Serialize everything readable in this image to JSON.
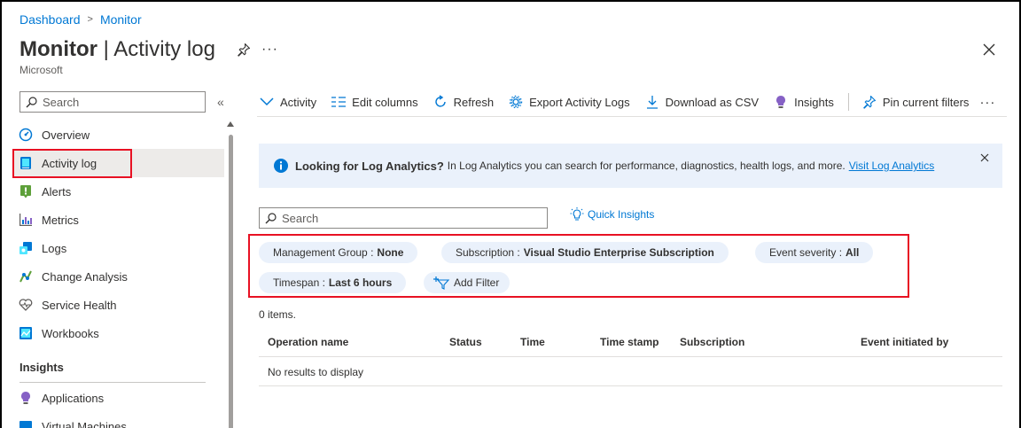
{
  "breadcrumb": {
    "item1": "Dashboard",
    "sep": ">",
    "item2": "Monitor"
  },
  "header": {
    "title_bold": "Monitor",
    "title_rest": " | Activity log",
    "subtitle": "Microsoft",
    "more": "···"
  },
  "sidebar": {
    "search_placeholder": "Search",
    "collapse": "«",
    "items": [
      {
        "label": "Overview",
        "icon": "gauge-icon"
      },
      {
        "label": "Activity log",
        "icon": "activity-log-icon",
        "active": true
      },
      {
        "label": "Alerts",
        "icon": "alerts-icon"
      },
      {
        "label": "Metrics",
        "icon": "metrics-icon"
      },
      {
        "label": "Logs",
        "icon": "logs-icon"
      },
      {
        "label": "Change Analysis",
        "icon": "change-analysis-icon"
      },
      {
        "label": "Service Health",
        "icon": "service-health-icon"
      },
      {
        "label": "Workbooks",
        "icon": "workbooks-icon"
      }
    ],
    "section_insights": "Insights",
    "insights_items": [
      {
        "label": "Applications",
        "icon": "applications-icon"
      },
      {
        "label": "Virtual Machines",
        "icon": "virtual-machines-icon"
      }
    ]
  },
  "toolbar": {
    "activity": "Activity",
    "edit_columns": "Edit columns",
    "refresh": "Refresh",
    "export": "Export Activity Logs",
    "download": "Download as CSV",
    "insights": "Insights",
    "pin": "Pin current filters",
    "more": "···"
  },
  "banner": {
    "title": "Looking for Log Analytics?",
    "text": "In Log Analytics you can search for performance, diagnostics, health logs, and more.",
    "link": "Visit Log Analytics"
  },
  "search": {
    "placeholder": "Search"
  },
  "quick_insights": "Quick Insights",
  "filters": {
    "management_group_label": "Management Group :",
    "management_group_value": "None",
    "subscription_label": "Subscription :",
    "subscription_value": "Visual Studio Enterprise Subscription",
    "event_severity_label": "Event severity :",
    "event_severity_value": "All",
    "timespan_label": "Timespan :",
    "timespan_value": "Last 6 hours",
    "add_filter": "Add Filter"
  },
  "items_count": "0 items.",
  "table": {
    "columns": [
      "Operation name",
      "Status",
      "Time",
      "Time stamp",
      "Subscription",
      "Event initiated by"
    ],
    "empty_text": "No results to display"
  },
  "colors": {
    "accent": "#0078d4",
    "highlight": "#e81123",
    "pill_bg": "#eaf1fb"
  }
}
